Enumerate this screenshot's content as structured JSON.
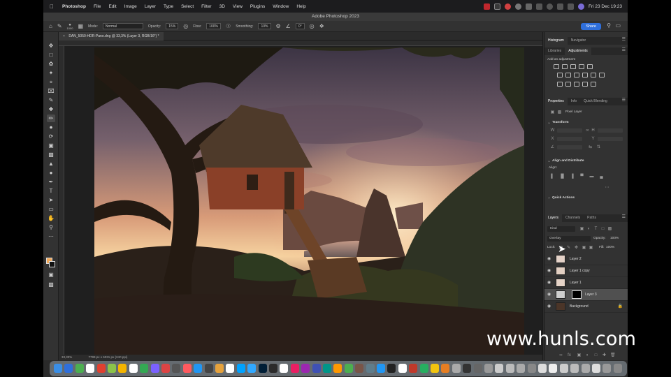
{
  "menubar": {
    "apple": "",
    "items": [
      "Photoshop",
      "File",
      "Edit",
      "Image",
      "Layer",
      "Type",
      "Select",
      "Filter",
      "3D",
      "View",
      "Plugins",
      "Window",
      "Help"
    ],
    "clock": "Fri 23 Dec 19:23"
  },
  "window": {
    "title": "Adobe Photoshop 2023"
  },
  "options": {
    "brush_size": "1000",
    "mode_label": "Mode:",
    "mode_value": "Normal",
    "opacity_label": "Opacity:",
    "opacity_value": "15%",
    "flow_label": "Flow:",
    "flow_value": "100%",
    "smoothing_label": "Smoothing:",
    "smoothing_value": "10%",
    "angle_value": "0°",
    "share_label": "Share"
  },
  "document": {
    "tab_title": "DAN_5050-HDR-Pano.dng @ 33,3% (Layer 3, RGB/16*) *",
    "zoom": "33,33%",
    "info": "7799 px x 6031 px (240 ppi)"
  },
  "plugins_strip": [
    "Ep",
    "im",
    "C",
    "Rp",
    "Pm"
  ],
  "panels": {
    "top_tabs": [
      "Histogram",
      "Navigator"
    ],
    "adj_tabs": [
      "Libraries",
      "Adjustments"
    ],
    "add_adjustment": "Add an adjustment",
    "prop_tabs": [
      "Properties",
      "Info",
      "Quick Blending"
    ],
    "pixel_layer": "Pixel Layer",
    "transform": "Transform",
    "align": "Align and Distribute",
    "align_sub": "Align:",
    "quick_actions": "Quick Actions",
    "layer_tabs": [
      "Layers",
      "Channels",
      "Paths"
    ],
    "kind": "Kind",
    "blend_mode": "Overlay",
    "opacity_label": "Opacity:",
    "opacity_value": "100%",
    "lock_label": "Lock:",
    "fill_label": "Fill:",
    "fill_value": "100%"
  },
  "layers": [
    {
      "name": "Layer 2",
      "thumb": "#e4d2c8",
      "mask": false,
      "selected": false
    },
    {
      "name": "Layer 1 copy",
      "thumb": "#e2cfc2",
      "mask": false,
      "selected": false
    },
    {
      "name": "Layer 1",
      "thumb": "#e6d4c8",
      "mask": false,
      "selected": false
    },
    {
      "name": "Layer 3",
      "thumb": "#cfcfcf",
      "mask": true,
      "selected": true
    },
    {
      "name": "Background",
      "thumb": "#4b3528",
      "mask": false,
      "selected": false,
      "locked": true
    }
  ],
  "watermark": "www.hunls.com",
  "colors": {
    "accent": "#2f6fdb",
    "foreground_swatch": "#f0a85a",
    "background_swatch": "#111111"
  }
}
